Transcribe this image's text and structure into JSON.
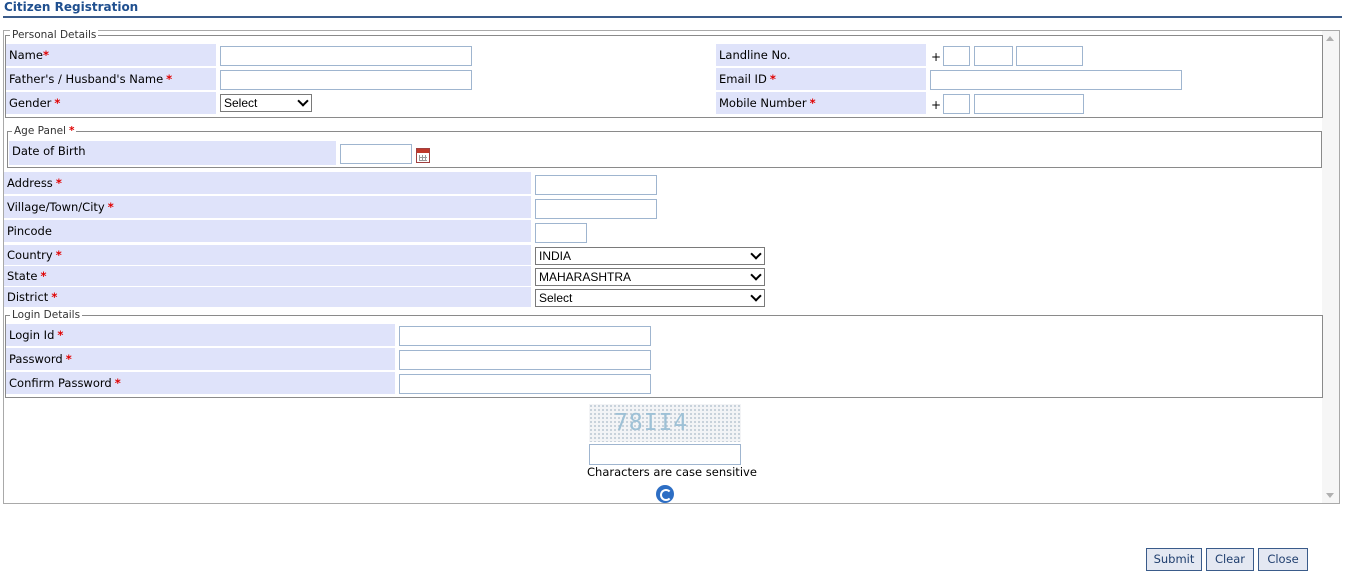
{
  "page": {
    "title": "Citizen Registration"
  },
  "personal": {
    "legend": "Personal Details",
    "name_label": "Name",
    "father_label": "Father's / Husband's Name",
    "gender_label": "Gender",
    "gender_value": "Select",
    "landline_label": "Landline No.",
    "email_label": "Email ID",
    "mobile_label": "Mobile Number",
    "plus": "+"
  },
  "age": {
    "legend": "Age Panel",
    "dob_label": "Date of Birth"
  },
  "address": {
    "address_label": "Address",
    "village_label": "Village/Town/City",
    "pincode_label": "Pincode",
    "country_label": "Country",
    "country_value": "INDIA",
    "state_label": "State",
    "state_value": "MAHARASHTRA",
    "district_label": "District",
    "district_value": "Select"
  },
  "login": {
    "legend": "Login Details",
    "login_label": "Login Id",
    "password_label": "Password",
    "confirm_label": "Confirm Password"
  },
  "captcha": {
    "image_text": "78II4",
    "note": "Characters are case sensitive"
  },
  "required_mark": "*",
  "buttons": {
    "submit": "Submit",
    "clear": "Clear",
    "close": "Close"
  }
}
